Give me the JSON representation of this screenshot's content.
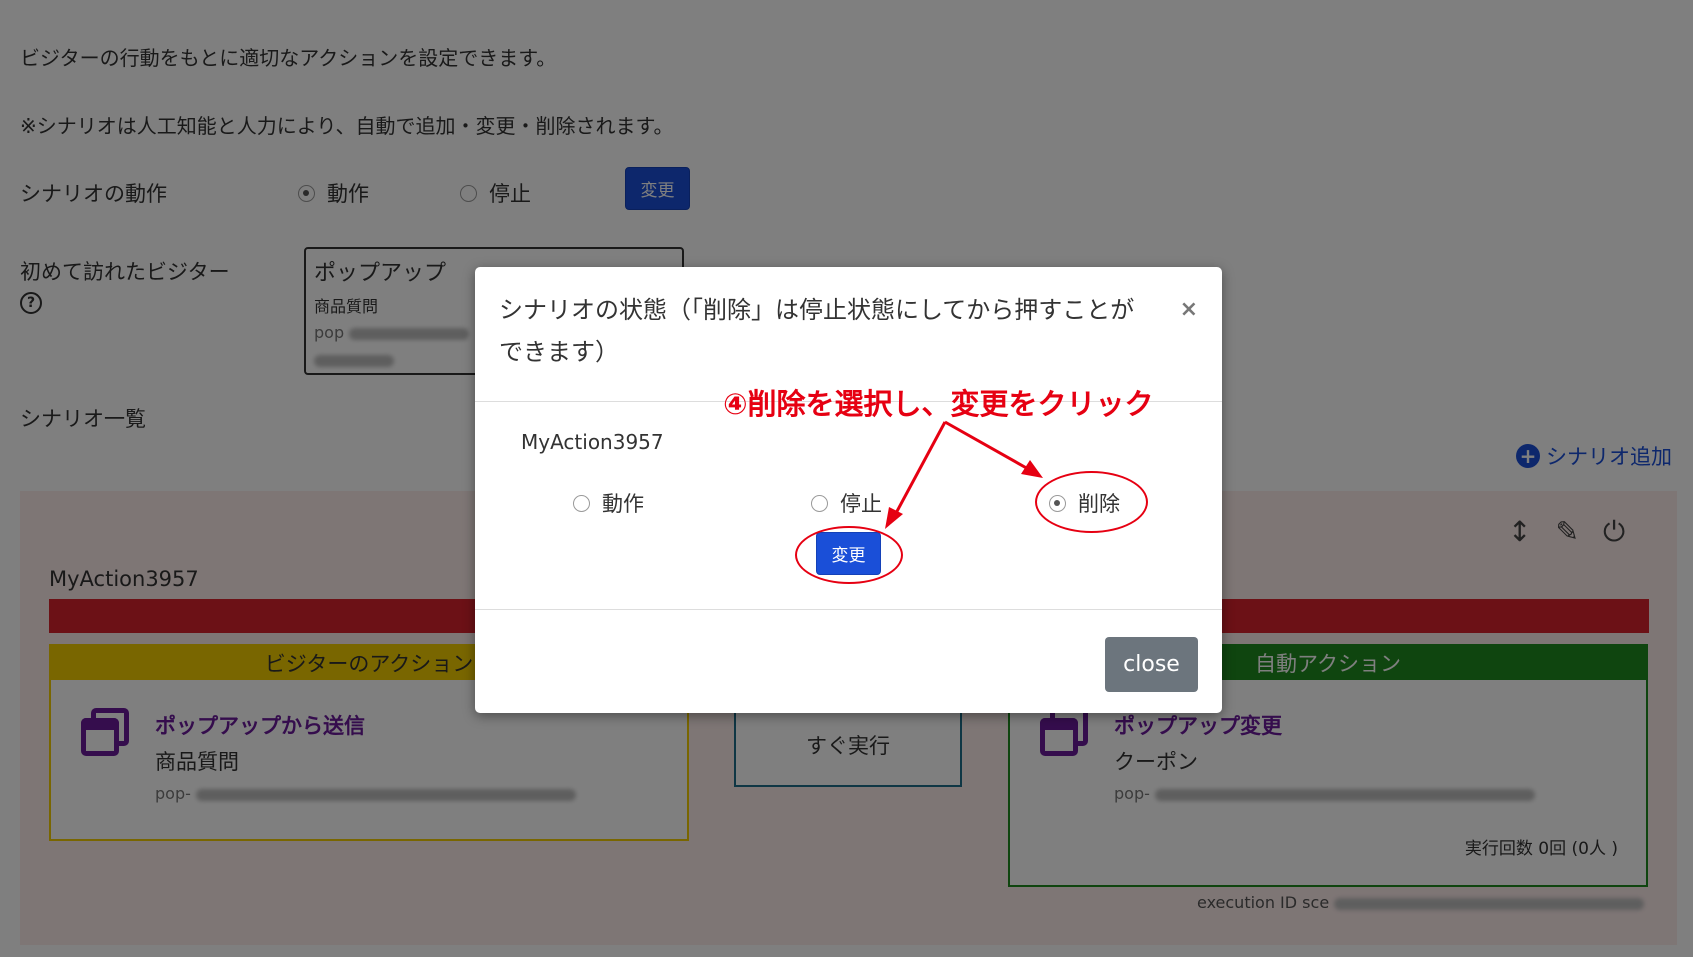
{
  "description": "ビジターの行動をもとに適切なアクションを設定できます。",
  "note": "※シナリオは人工知能と人力により、自動で追加・変更・削除されます。",
  "scenario_operation": {
    "label": "シナリオの動作",
    "options": [
      "動作",
      "停止"
    ],
    "selected": "動作",
    "change_button": "変更"
  },
  "first_visitor": {
    "label": "初めて訪れたビジター",
    "help_icon": "question-circle-icon",
    "popup": {
      "title": "ポップアップ",
      "subtitle": "商品質問",
      "id_prefix": "pop"
    }
  },
  "scenario_list": {
    "label": "シナリオ一覧",
    "add_link": "シナリオ追加"
  },
  "scenario_card": {
    "name": "MyAction3957",
    "icons": [
      "sort-icon",
      "pencil-icon",
      "power-icon"
    ],
    "visitor_action": {
      "header": "ビジターのアクション",
      "title": "ポップアップから送信",
      "subtitle": "商品質問",
      "id_prefix": "pop-"
    },
    "timing": {
      "label": "すぐ実行"
    },
    "auto_action": {
      "header": "自動アクション",
      "title": "ポップアップ変更",
      "subtitle": "クーポン",
      "id_prefix": "pop-",
      "exec_count": "実行回数 0回 (0人 )"
    },
    "execution_id_prefix": "execution ID sce"
  },
  "modal": {
    "title": "シナリオの状態（「削除」は停止状態にしてから押すことができます）",
    "scenario_name": "MyAction3957",
    "options": [
      "動作",
      "停止",
      "削除"
    ],
    "selected": "削除",
    "change_button": "変更",
    "close_button": "close",
    "close_x": "×"
  },
  "annotation": "④削除を選択し、変更をクリック",
  "colors": {
    "primary": "#1a4fd8",
    "red_bar": "#d9232d",
    "visitor_panel": "#f2cc00",
    "timing_panel": "#1f6f8b",
    "auto_panel": "#1f8a1f",
    "purple": "#6a1b9a",
    "annotation": "#e60012"
  }
}
